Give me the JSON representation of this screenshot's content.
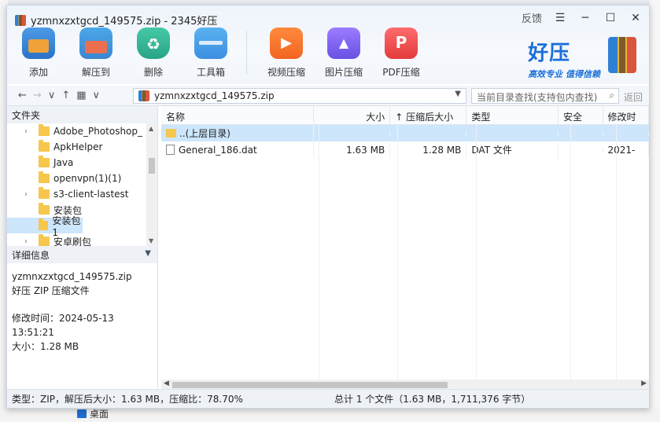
{
  "window": {
    "title": "yzmnxzxtgcd_149575.zip - 2345好压",
    "feedback": "反馈",
    "menu": "☰",
    "minimize": "─",
    "maximize": "☐",
    "close": "✕"
  },
  "toolbar": {
    "add": "添加",
    "extract": "解压到",
    "delete": "删除",
    "toolbox": "工具箱",
    "video": "视频压缩",
    "image": "图片压缩",
    "pdf": "PDF压缩"
  },
  "brand": {
    "name": "好压",
    "slogan": "高效专业 值得信赖"
  },
  "address": {
    "path": "yzmnxzxtgcd_149575.zip",
    "search_placeholder": "当前目录查找(支持包内查找)",
    "old_version": "返回"
  },
  "sidebar": {
    "header": "文件夹",
    "folders": [
      {
        "label": "Adobe_Photoshop_",
        "expandable": true
      },
      {
        "label": "ApkHelper",
        "expandable": false
      },
      {
        "label": "Java",
        "expandable": false
      },
      {
        "label": "openvpn(1)(1)",
        "expandable": false
      },
      {
        "label": "s3-client-lastest",
        "expandable": true
      },
      {
        "label": "安装包",
        "expandable": false
      },
      {
        "label": "安装包1",
        "expandable": false,
        "selected": true
      },
      {
        "label": "安卓刷包",
        "expandable": true
      }
    ]
  },
  "details": {
    "header": "详细信息",
    "filename": "yzmnxzxtgcd_149575.zip",
    "filetype": "好压 ZIP 压缩文件",
    "modified": "修改时间：2024-05-13 13:51:21",
    "size": "大小：1.28 MB"
  },
  "columns": {
    "name": "名称",
    "size": "大小",
    "compressed": "压缩后大小",
    "type": "类型",
    "security": "安全",
    "modified": "修改时"
  },
  "rows": [
    {
      "name": "..(上层目录)",
      "size": "",
      "compressed": "",
      "type": "",
      "security": "",
      "modified": ""
    },
    {
      "name": "General_186.dat",
      "size": "1.63 MB",
      "compressed": "1.28 MB",
      "type": "DAT 文件",
      "security": "",
      "modified": "2021-"
    }
  ],
  "status": {
    "left": "类型：ZIP，解压后大小：1.63 MB，压缩比：78.70%",
    "right": "总计 1 个文件（1.63 MB，1,711,376 字节）"
  },
  "desktop": {
    "label": "桌面"
  }
}
